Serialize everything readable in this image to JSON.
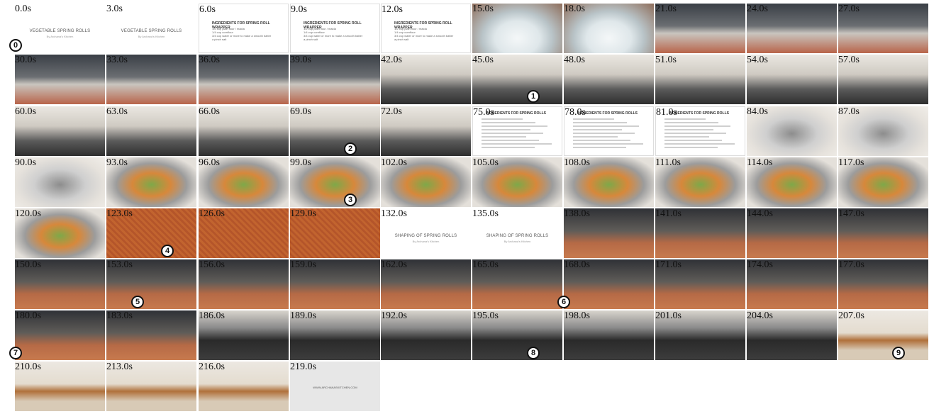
{
  "timestamps": [
    "0.0s",
    "3.0s",
    "6.0s",
    "9.0s",
    "12.0s",
    "15.0s",
    "18.0s",
    "21.0s",
    "24.0s",
    "27.0s",
    "30.0s",
    "33.0s",
    "36.0s",
    "39.0s",
    "42.0s",
    "45.0s",
    "48.0s",
    "51.0s",
    "54.0s",
    "57.0s",
    "60.0s",
    "63.0s",
    "66.0s",
    "69.0s",
    "72.0s",
    "75.0s",
    "78.0s",
    "81.0s",
    "84.0s",
    "87.0s",
    "90.0s",
    "93.0s",
    "96.0s",
    "99.0s",
    "102.0s",
    "105.0s",
    "108.0s",
    "111.0s",
    "114.0s",
    "117.0s",
    "120.0s",
    "123.0s",
    "126.0s",
    "129.0s",
    "132.0s",
    "135.0s",
    "138.0s",
    "141.0s",
    "144.0s",
    "147.0s",
    "150.0s",
    "153.0s",
    "156.0s",
    "159.0s",
    "162.0s",
    "165.0s",
    "168.0s",
    "171.0s",
    "174.0s",
    "177.0s",
    "180.0s",
    "183.0s",
    "186.0s",
    "189.0s",
    "192.0s",
    "195.0s",
    "198.0s",
    "201.0s",
    "204.0s",
    "207.0s",
    "210.0s",
    "213.0s",
    "216.0s",
    "219.0s"
  ],
  "step_markers": [
    "0",
    "1",
    "2",
    "3",
    "4",
    "5",
    "6",
    "7",
    "8",
    "9"
  ],
  "slides": {
    "title": "VEGETABLE SPRING ROLLS",
    "byline": "By Archana's Kitchen",
    "wrapper_heading": "INGREDIENTS FOR SPRING ROLL WRAPPER",
    "wrapper_lines": [
      "1/2 cup plain flour / maida",
      "1/4 cup cornflour",
      "3/4 cup water or more to make a smooth batter",
      "a pinch salt"
    ],
    "filling_heading": "INGREDIENTS FOR SPRING ROLLS",
    "shaping_title": "SHAPING OF SPRING ROLLS",
    "website": "WWW.ARCHANASKITCHEN.COM"
  }
}
